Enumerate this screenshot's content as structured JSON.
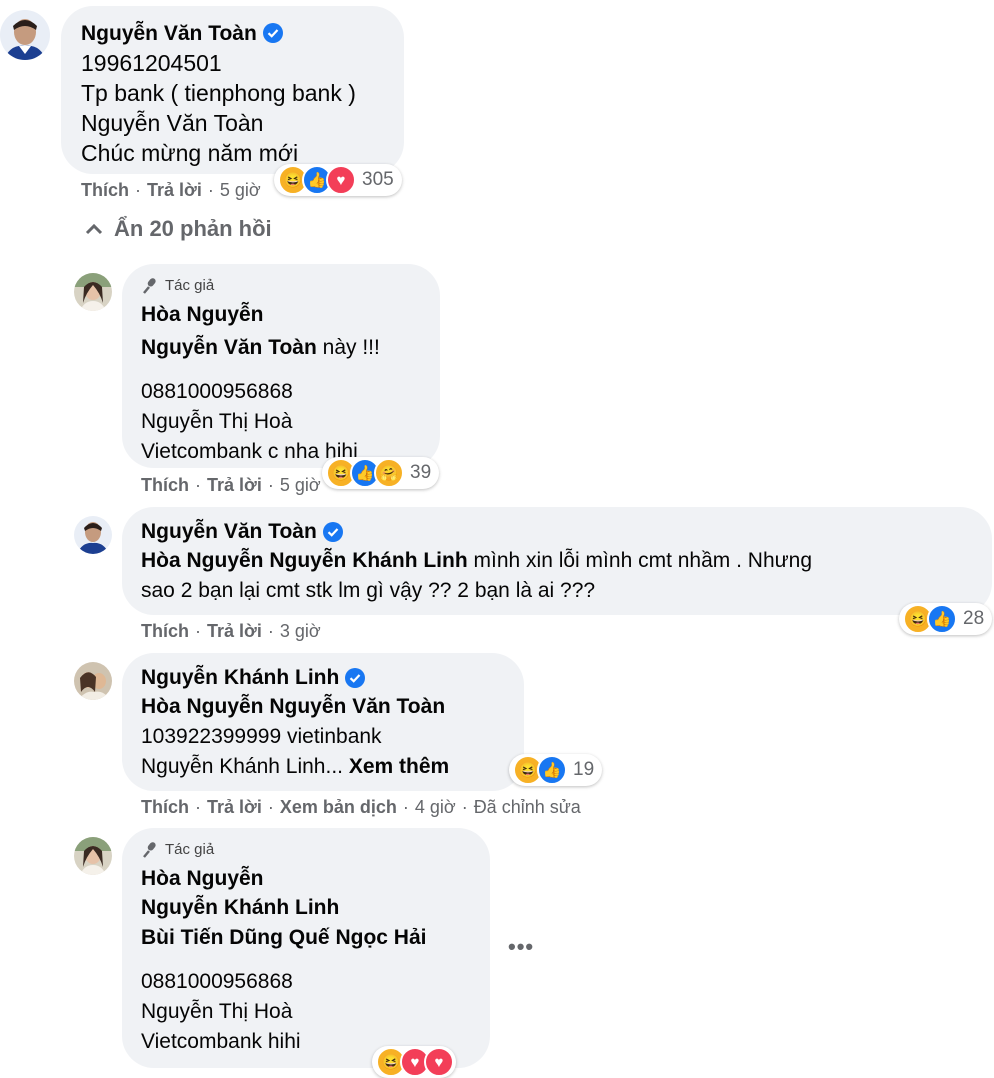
{
  "top_comment": {
    "author": "Nguyễn Văn Toàn",
    "lines": [
      "19961204501",
      "Tp bank ( tienphong bank )",
      "Nguyễn Văn Toàn",
      "Chúc mừng năm mới"
    ],
    "like_label": "Thích",
    "reply_label": "Trả lời",
    "time": "5 giờ",
    "reaction_count": "305"
  },
  "hide_replies_label": "Ẩn 20 phản hồi",
  "replies": [
    {
      "author_tag": "Tác giả",
      "author": "Hòa Nguyễn",
      "mention": "Nguyễn Văn Toàn",
      "mention_suffix": "này !!!",
      "lines": [
        "0881000956868",
        "Nguyễn Thị Hoà",
        "Vietcombank c nha hihi"
      ],
      "like_label": "Thích",
      "reply_label": "Trả lời",
      "time": "5 giờ",
      "reaction_count": "39"
    },
    {
      "author": "Nguyễn Văn Toàn",
      "mention": "Hòa Nguyễn Nguyễn Khánh Linh",
      "text_1": "mình xin lỗi mình cmt nhầm . Nhưng",
      "text_2": "sao 2 bạn lại cmt stk lm gì vậy ?? 2 bạn là ai ???",
      "like_label": "Thích",
      "reply_label": "Trả lời",
      "time": "3 giờ",
      "reaction_count": "28"
    },
    {
      "author": "Nguyễn Khánh Linh",
      "mention": "Hòa Nguyễn Nguyễn Văn Toàn",
      "line_1": "103922399999 vietinbank",
      "line_2": "Nguyễn Khánh Linh...",
      "see_more": "Xem thêm",
      "like_label": "Thích",
      "reply_label": "Trả lời",
      "translate_label": "Xem bản dịch",
      "time": "4 giờ",
      "edited": "Đã chỉnh sửa",
      "reaction_count": "19"
    },
    {
      "author_tag": "Tác giả",
      "author": "Hòa Nguyễn",
      "mention_1": "Nguyễn Khánh Linh",
      "mention_2": "Bùi Tiến Dũng Quế Ngọc Hải",
      "lines": [
        "0881000956868",
        "Nguyễn Thị Hoà",
        "Vietcombank hihi"
      ]
    }
  ],
  "colors": {
    "bubble": "#f0f2f5",
    "muted": "#65676b",
    "verified": "#1877f2"
  }
}
